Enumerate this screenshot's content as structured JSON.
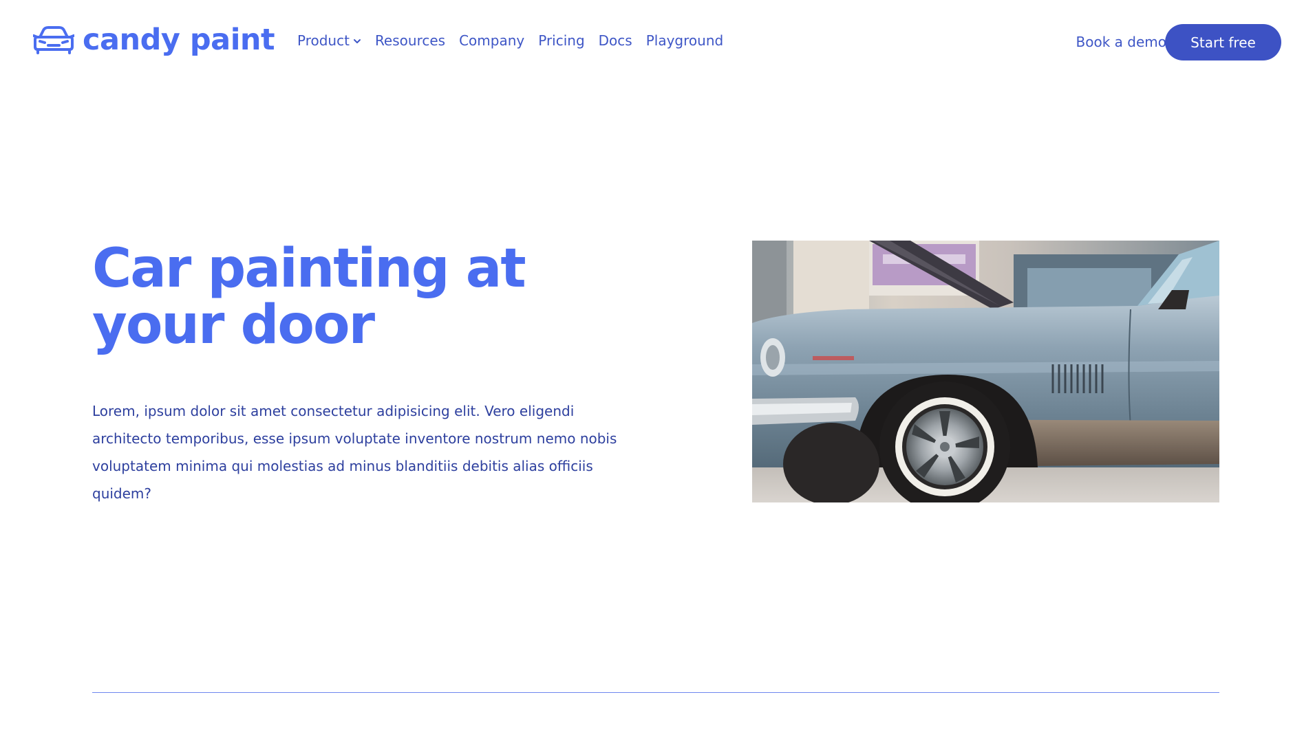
{
  "brand": {
    "name": "candy paint",
    "icon": "car-front-icon",
    "color": "#4a6df0"
  },
  "nav": {
    "items": [
      {
        "label": "Product",
        "has_dropdown": true
      },
      {
        "label": "Resources",
        "has_dropdown": false
      },
      {
        "label": "Company",
        "has_dropdown": false
      },
      {
        "label": "Pricing",
        "has_dropdown": false
      },
      {
        "label": "Docs",
        "has_dropdown": false
      },
      {
        "label": "Playground",
        "has_dropdown": false
      }
    ],
    "book_demo_label": "Book a demo",
    "start_free_label": "Start free",
    "cta_color": "#3d52c4"
  },
  "hero": {
    "title": "Car painting at your door",
    "body": "Lorem, ipsum dolor sit amet consectetur adipisicing elit. Vero eligendi architecto temporibus, esse ipsum voluptate inventore nostrum nemo nobis voluptatem minima qui molestias ad minus blanditiis debitis alias officiis quidem?",
    "image": "classic-blue-car-photo"
  },
  "colors": {
    "heading": "#4a6df0",
    "body_text": "#2d3f9e",
    "nav_text": "#3e56c6",
    "divider": "#6d86ef"
  }
}
